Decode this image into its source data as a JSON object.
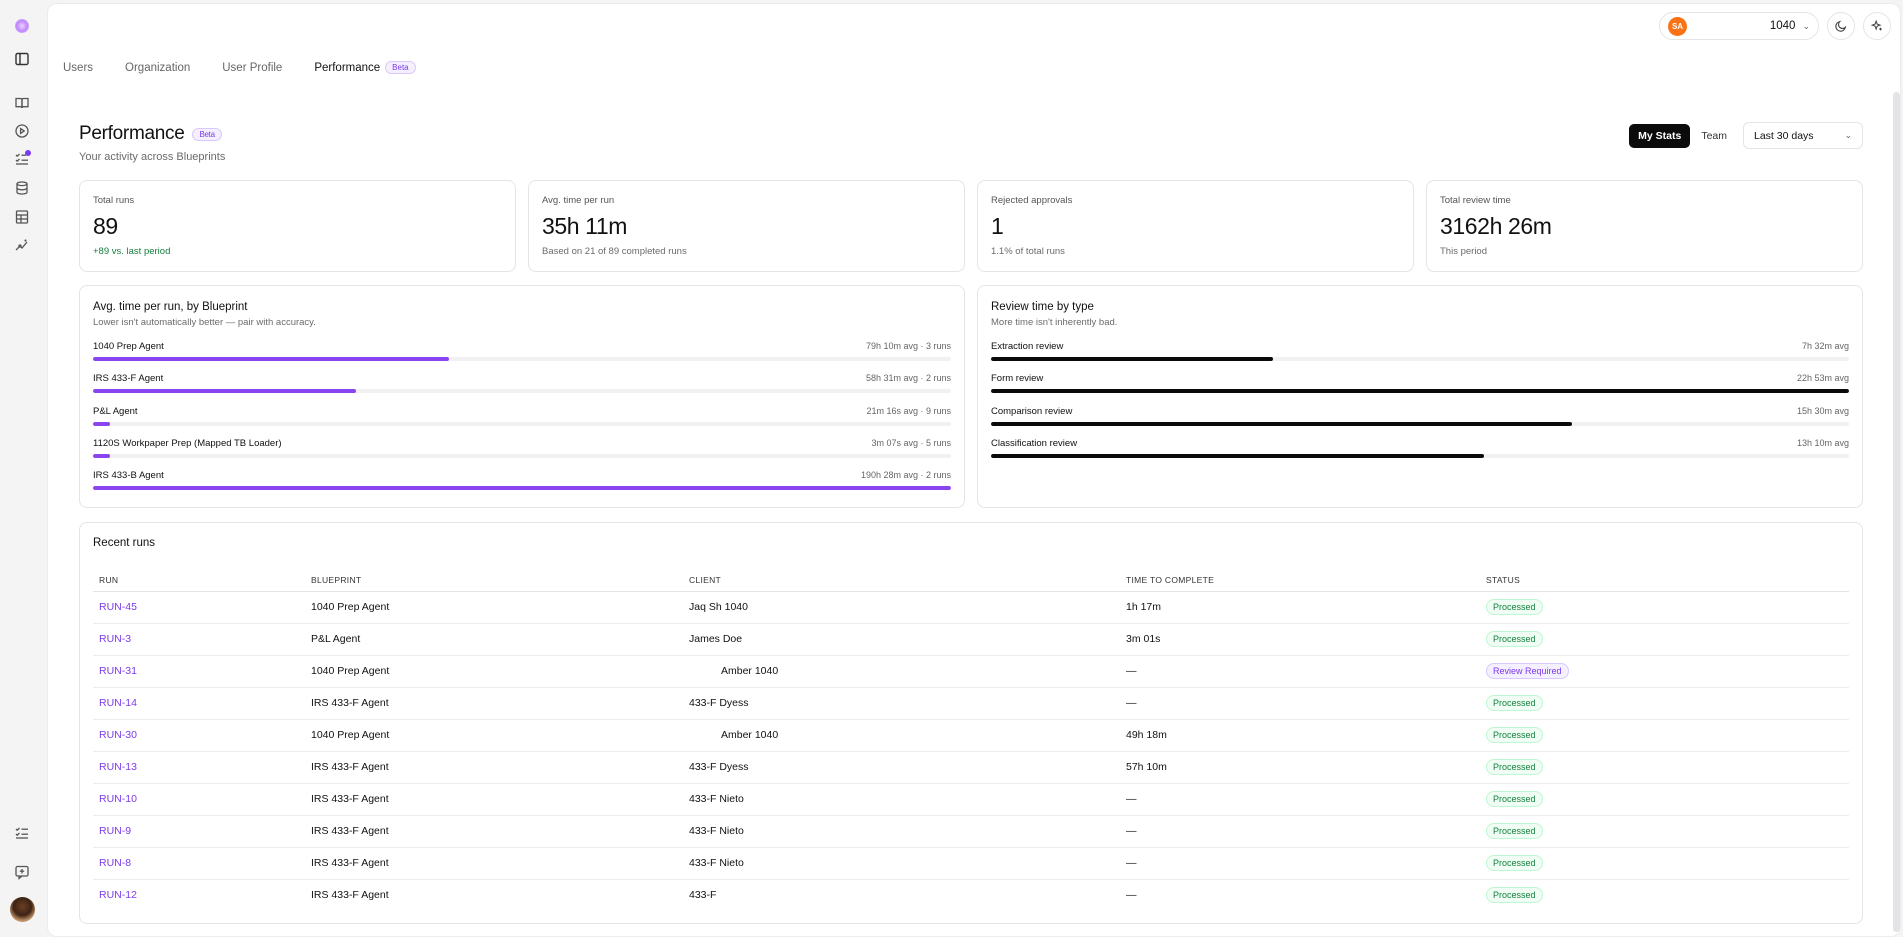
{
  "rail": {
    "icons": [
      "logo-icon",
      "sidebar-toggle-icon",
      "book-icon",
      "play-icon",
      "tasks-icon",
      "database-icon",
      "table-icon",
      "sparkle-icon",
      "checklist-icon",
      "feedback-icon"
    ]
  },
  "nav": {
    "tabs": [
      {
        "label": "Users"
      },
      {
        "label": "Organization"
      },
      {
        "label": "User Profile"
      },
      {
        "label": "Performance",
        "badge": "Beta",
        "active": true
      }
    ]
  },
  "header": {
    "org_initials": "SA",
    "org_name": "1040"
  },
  "page": {
    "title": "Performance",
    "badge": "Beta",
    "subtitle": "Your activity across Blueprints"
  },
  "controls": {
    "my_stats": "My Stats",
    "team": "Team",
    "range": "Last 30 days"
  },
  "stats": [
    {
      "label": "Total runs",
      "value": "89",
      "note": "+89 vs. last period"
    },
    {
      "label": "Avg. time per run",
      "value": "35h 11m",
      "note": "Based on 21 of 89 completed runs"
    },
    {
      "label": "Rejected approvals",
      "value": "1",
      "note": "1.1% of total runs"
    },
    {
      "label": "Total review time",
      "value": "3162h 26m",
      "note": "This period"
    }
  ],
  "blueprint_panel": {
    "title": "Avg. time per run, by Blueprint",
    "subtitle": "Lower isn't automatically better — pair with accuracy.",
    "rows": [
      {
        "name": "1040 Prep Agent",
        "meta": "79h 10m avg · 3 runs",
        "fraction": 0.415
      },
      {
        "name": "IRS 433-F Agent",
        "meta": "58h 31m avg · 2 runs",
        "fraction": 0.307
      },
      {
        "name": "P&L Agent",
        "meta": "21m 16s avg · 9 runs",
        "fraction": 0.02
      },
      {
        "name": "1120S Workpaper Prep (Mapped TB Loader)",
        "meta": "3m 07s avg · 5 runs",
        "fraction": 0.02
      },
      {
        "name": "IRS 433-B Agent",
        "meta": "190h 28m avg · 2 runs",
        "fraction": 1.0
      }
    ]
  },
  "review_panel": {
    "title": "Review time by type",
    "subtitle": "More time isn't inherently bad.",
    "rows": [
      {
        "name": "Extraction review",
        "meta": "7h 32m avg",
        "fraction": 0.329
      },
      {
        "name": "Form review",
        "meta": "22h 53m avg",
        "fraction": 1.0
      },
      {
        "name": "Comparison review",
        "meta": "15h 30m avg",
        "fraction": 0.677
      },
      {
        "name": "Classification review",
        "meta": "13h 10m avg",
        "fraction": 0.575
      }
    ]
  },
  "recent_runs": {
    "title": "Recent runs",
    "columns": [
      "RUN",
      "BLUEPRINT",
      "CLIENT",
      "TIME TO COMPLETE",
      "STATUS"
    ],
    "rows": [
      {
        "run": "RUN-45",
        "blueprint": "1040 Prep Agent",
        "client": "Jaq Sh 1040",
        "indent": false,
        "time": "1h 17m",
        "status": "Processed"
      },
      {
        "run": "RUN-3",
        "blueprint": "P&L Agent",
        "client": "James Doe",
        "indent": false,
        "time": "3m 01s",
        "status": "Processed"
      },
      {
        "run": "RUN-31",
        "blueprint": "1040 Prep Agent",
        "client": "Amber 1040",
        "indent": true,
        "time": "—",
        "status": "Review Required"
      },
      {
        "run": "RUN-14",
        "blueprint": "IRS 433-F Agent",
        "client": "433-F Dyess",
        "indent": false,
        "time": "—",
        "status": "Processed"
      },
      {
        "run": "RUN-30",
        "blueprint": "1040 Prep Agent",
        "client": "Amber 1040",
        "indent": true,
        "time": "49h 18m",
        "status": "Processed"
      },
      {
        "run": "RUN-13",
        "blueprint": "IRS 433-F Agent",
        "client": "433-F Dyess",
        "indent": false,
        "time": "57h 10m",
        "status": "Processed"
      },
      {
        "run": "RUN-10",
        "blueprint": "IRS 433-F Agent",
        "client": "433-F Nieto",
        "indent": false,
        "time": "—",
        "status": "Processed"
      },
      {
        "run": "RUN-9",
        "blueprint": "IRS 433-F Agent",
        "client": "433-F Nieto",
        "indent": false,
        "time": "—",
        "status": "Processed"
      },
      {
        "run": "RUN-8",
        "blueprint": "IRS 433-F Agent",
        "client": "433-F Nieto",
        "indent": false,
        "time": "—",
        "status": "Processed"
      },
      {
        "run": "RUN-12",
        "blueprint": "IRS 433-F Agent",
        "client": "433-F",
        "indent": false,
        "time": "—",
        "status": "Processed"
      }
    ]
  }
}
